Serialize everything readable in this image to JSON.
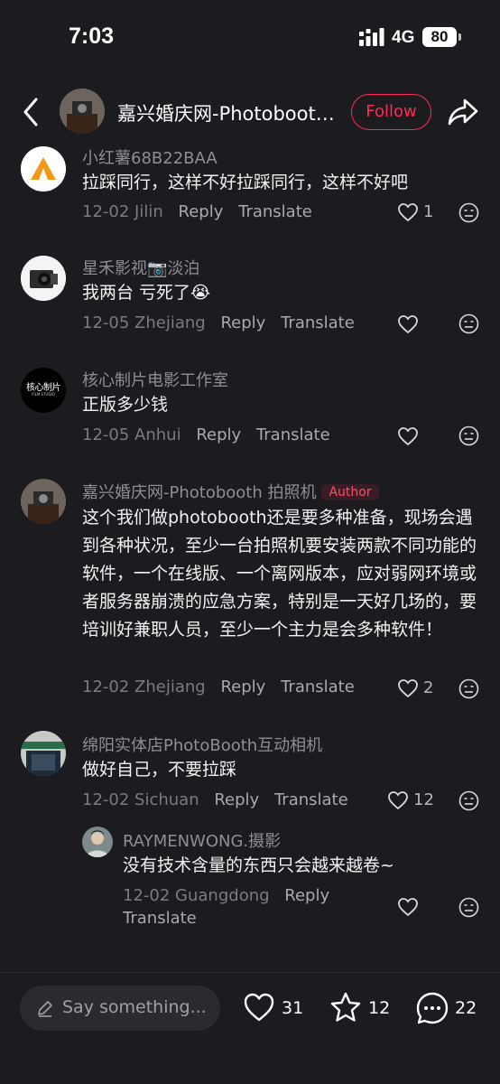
{
  "status": {
    "time": "7:03",
    "network": "4G",
    "battery": "80"
  },
  "header": {
    "title": "嘉兴婚庆网-Photobooth拍照机",
    "follow_label": "Follow"
  },
  "comments": [
    {
      "username": "小红薯68B22BAA",
      "text": "拉踩同行，这样不好拉踩同行，这样不好吧",
      "date": "12-02",
      "location": "Jilin",
      "reply": "Reply",
      "translate": "Translate",
      "likes": "1"
    },
    {
      "username": "星禾影视📷淡泊",
      "text": "我两台 亏死了😭",
      "date": "12-05",
      "location": "Zhejiang",
      "reply": "Reply",
      "translate": "Translate",
      "likes": ""
    },
    {
      "username": "核心制片电影工作室",
      "avatar_text": "核心制片",
      "avatar_sub": "FILM STUDIO",
      "text": "正版多少钱",
      "date": "12-05",
      "location": "Anhui",
      "reply": "Reply",
      "translate": "Translate",
      "likes": ""
    },
    {
      "username": "嘉兴婚庆网-Photobooth 拍照机",
      "badge": "Author",
      "text": "这个我们做photobooth还是要多种准备，现场会遇到各种状况，至少一台拍照机要安装两款不同功能的软件，一个在线版、一个离网版本，应对弱网环境或者服务器崩溃的应急方案，特别是一天好几场的，要培训好兼职人员，至少一个主力是会多种软件！",
      "date": "12-02",
      "location": "Zhejiang",
      "reply": "Reply",
      "translate": "Translate",
      "likes": "2"
    },
    {
      "username": "绵阳实体店PhotoBooth互动相机",
      "text": "做好自己，不要拉踩",
      "date": "12-02",
      "location": "Sichuan",
      "reply": "Reply",
      "translate": "Translate",
      "likes": "12"
    },
    {
      "username": "RAYMENWONG.摄影",
      "text": "没有技术含量的东西只会越来越卷~",
      "date": "12-02",
      "location": "Guangdong",
      "reply": "Reply",
      "translate": "Translate",
      "likes": ""
    }
  ],
  "bottom": {
    "placeholder": "Say something...",
    "likes": "31",
    "favorites": "12",
    "comments": "22"
  }
}
